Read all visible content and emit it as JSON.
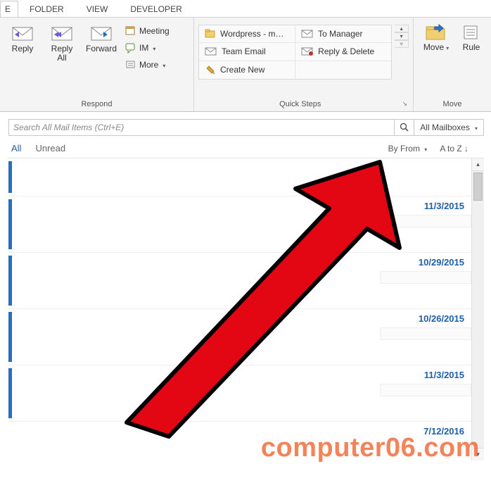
{
  "tabs": {
    "home_suffix": "E",
    "folder": "FOLDER",
    "view": "VIEW",
    "developer": "DEVELOPER"
  },
  "ribbon": {
    "respond": {
      "label": "Respond",
      "reply": "Reply",
      "reply_all": "Reply\nAll",
      "forward": "Forward",
      "meeting": "Meeting",
      "im": "IM",
      "more": "More"
    },
    "quicksteps": {
      "label": "Quick Steps",
      "wordpress": "Wordpress - m…",
      "team_email": "Team Email",
      "create_new": "Create New",
      "to_manager": "To Manager",
      "reply_delete": "Reply & Delete"
    },
    "move": {
      "label": "Move",
      "move": "Move",
      "rules": "Rule"
    }
  },
  "search": {
    "placeholder": "Search All Mail Items (Ctrl+E)",
    "scope": "All Mailboxes"
  },
  "filter": {
    "all": "All",
    "unread": "Unread",
    "sort_by": "By From",
    "order": "A to Z ↓"
  },
  "messages": [
    {
      "date": ""
    },
    {
      "date": "11/3/2015"
    },
    {
      "date": "10/29/2015"
    },
    {
      "date": "10/26/2015"
    },
    {
      "date": "11/3/2015"
    },
    {
      "date": "7/12/2016"
    }
  ],
  "watermark": "computer06.com"
}
